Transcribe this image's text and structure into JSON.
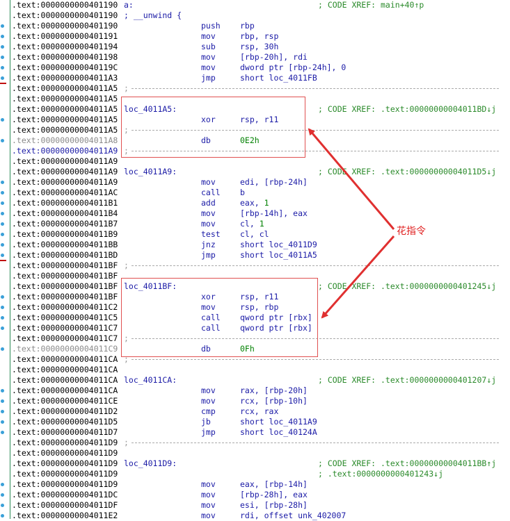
{
  "annotation_label": "花指令",
  "rows": [
    {
      "addr": ".text:0000000000401190",
      "label": "a:",
      "cmt": "; CODE XREF: main+40↑p"
    },
    {
      "addr": ".text:0000000000401190",
      "label": "; __unwind {"
    },
    {
      "addr": ".text:0000000000401190",
      "mnem": "push",
      "ops": "rbp"
    },
    {
      "addr": ".text:0000000000401191",
      "mnem": "mov",
      "ops": "rbp, rsp"
    },
    {
      "addr": ".text:0000000000401194",
      "mnem": "sub",
      "ops": "rsp, 30h"
    },
    {
      "addr": ".text:0000000000401198",
      "mnem": "mov",
      "ops": "[rbp-20h], rdi"
    },
    {
      "addr": ".text:000000000040119C",
      "mnem": "mov",
      "ops": "dword ptr [rbp-24h], 0"
    },
    {
      "addr": ".text:00000000004011A3",
      "mnem": "jmp",
      "ops": "short loc_4011FB"
    },
    {
      "addr": ".text:00000000004011A5",
      "sep": ";"
    },
    {
      "addr": ".text:00000000004011A5"
    },
    {
      "addr": ".text:00000000004011A5",
      "label": "loc_4011A5:",
      "cmt": "; CODE XREF: .text:00000000004011BD↓j"
    },
    {
      "addr": ".text:00000000004011A5",
      "mnem": "xor",
      "ops": "rsp, r11"
    },
    {
      "addr": ".text:00000000004011A5",
      "sep": ";"
    },
    {
      "addr": ".text:00000000004011A8",
      "mnem": "db",
      "ops": "0E2h",
      "style": "gray"
    },
    {
      "addr": ".text:00000000004011A9",
      "sep": ";",
      "style": "blue"
    },
    {
      "addr": ".text:00000000004011A9"
    },
    {
      "addr": ".text:00000000004011A9",
      "label": "loc_4011A9:",
      "cmt": "; CODE XREF: .text:00000000004011D5↓j"
    },
    {
      "addr": ".text:00000000004011A9",
      "mnem": "mov",
      "ops": "edi, [rbp-24h]"
    },
    {
      "addr": ".text:00000000004011AC",
      "mnem": "call",
      "ops": "b"
    },
    {
      "addr": ".text:00000000004011B1",
      "mnem": "add",
      "ops": "eax, 1"
    },
    {
      "addr": ".text:00000000004011B4",
      "mnem": "mov",
      "ops": "[rbp-14h], eax"
    },
    {
      "addr": ".text:00000000004011B7",
      "mnem": "mov",
      "ops": "cl, 1"
    },
    {
      "addr": ".text:00000000004011B9",
      "mnem": "test",
      "ops": "cl, cl"
    },
    {
      "addr": ".text:00000000004011BB",
      "mnem": "jnz",
      "ops": "short loc_4011D9"
    },
    {
      "addr": ".text:00000000004011BD",
      "mnem": "jmp",
      "ops": "short loc_4011A5"
    },
    {
      "addr": ".text:00000000004011BF",
      "sep": ";"
    },
    {
      "addr": ".text:00000000004011BF"
    },
    {
      "addr": ".text:00000000004011BF",
      "label": "loc_4011BF:",
      "cmt": "; CODE XREF: .text:0000000000401245↓j"
    },
    {
      "addr": ".text:00000000004011BF",
      "mnem": "xor",
      "ops": "rsp, r11"
    },
    {
      "addr": ".text:00000000004011C2",
      "mnem": "mov",
      "ops": "rsp, rbp"
    },
    {
      "addr": ".text:00000000004011C5",
      "mnem": "call",
      "ops": "qword ptr [rbx]"
    },
    {
      "addr": ".text:00000000004011C7",
      "mnem": "call",
      "ops": "qword ptr [rbx]"
    },
    {
      "addr": ".text:00000000004011C7",
      "sep": ";"
    },
    {
      "addr": ".text:00000000004011C9",
      "mnem": "db",
      "ops": "0Fh",
      "style": "gray"
    },
    {
      "addr": ".text:00000000004011CA",
      "sep": ";"
    },
    {
      "addr": ".text:00000000004011CA"
    },
    {
      "addr": ".text:00000000004011CA",
      "label": "loc_4011CA:",
      "cmt": "; CODE XREF: .text:0000000000401207↓j"
    },
    {
      "addr": ".text:00000000004011CA",
      "mnem": "mov",
      "ops": "rax, [rbp-20h]"
    },
    {
      "addr": ".text:00000000004011CE",
      "mnem": "mov",
      "ops": "rcx, [rbp-10h]"
    },
    {
      "addr": ".text:00000000004011D2",
      "mnem": "cmp",
      "ops": "rcx, rax"
    },
    {
      "addr": ".text:00000000004011D5",
      "mnem": "jb",
      "ops": "short loc_4011A9"
    },
    {
      "addr": ".text:00000000004011D7",
      "mnem": "jmp",
      "ops": "short loc_40124A"
    },
    {
      "addr": ".text:00000000004011D9",
      "sep": ";"
    },
    {
      "addr": ".text:00000000004011D9"
    },
    {
      "addr": ".text:00000000004011D9",
      "label": "loc_4011D9:",
      "cmt": "; CODE XREF: .text:00000000004011BB↑j"
    },
    {
      "addr": ".text:00000000004011D9",
      "cmt": "; .text:0000000000401243↓j"
    },
    {
      "addr": ".text:00000000004011D9",
      "mnem": "mov",
      "ops": "eax, [rbp-14h]"
    },
    {
      "addr": ".text:00000000004011DC",
      "mnem": "mov",
      "ops": "[rbp-28h], eax"
    },
    {
      "addr": ".text:00000000004011DF",
      "mnem": "mov",
      "ops": "esi, [rbp-28h]"
    },
    {
      "addr": ".text:00000000004011E2",
      "mnem": "mov",
      "ops": "rdi, offset unk_402007"
    }
  ]
}
